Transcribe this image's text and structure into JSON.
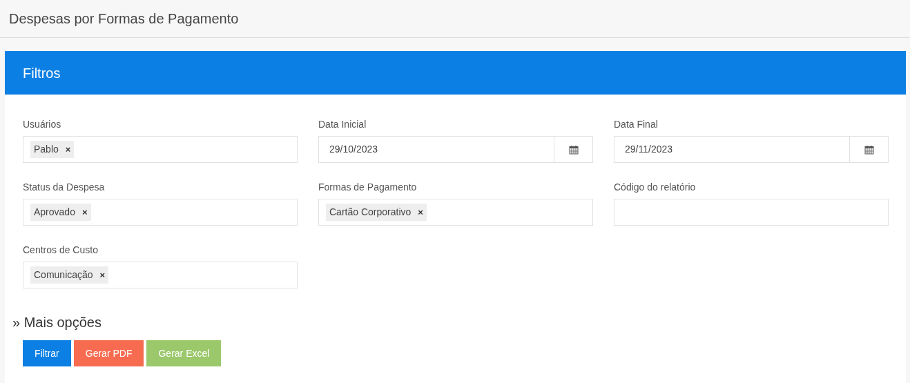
{
  "page_title": "Despesas por Formas de Pagamento",
  "panel": {
    "title": "Filtros"
  },
  "fields": [
    {
      "kind": "tags",
      "label": "Usuários",
      "tags": [
        {
          "label": "Pablo",
          "remove": "×"
        }
      ]
    },
    {
      "kind": "date",
      "label": "Data Inicial",
      "value": "29/10/2023"
    },
    {
      "kind": "date",
      "label": "Data Final",
      "value": "29/11/2023"
    },
    {
      "kind": "tags",
      "label": "Status da Despesa",
      "tags": [
        {
          "label": "Aprovado",
          "remove": "×"
        }
      ]
    },
    {
      "kind": "tags",
      "label": "Formas de Pagamento",
      "tags": [
        {
          "label": "Cartão Corporativo",
          "remove": "×"
        }
      ]
    },
    {
      "kind": "text",
      "label": "Código do relatório"
    },
    {
      "kind": "tags",
      "label": "Centros de Custo",
      "tags": [
        {
          "label": "Comunicação",
          "remove": "×"
        }
      ]
    }
  ],
  "more_options": "» Mais opções",
  "buttons": [
    {
      "label": "Filtrar",
      "color": "#0b7fe3"
    },
    {
      "label": "Gerar PDF",
      "color": "#f76c51"
    },
    {
      "label": "Gerar Excel",
      "color": "#9bc86b"
    }
  ]
}
